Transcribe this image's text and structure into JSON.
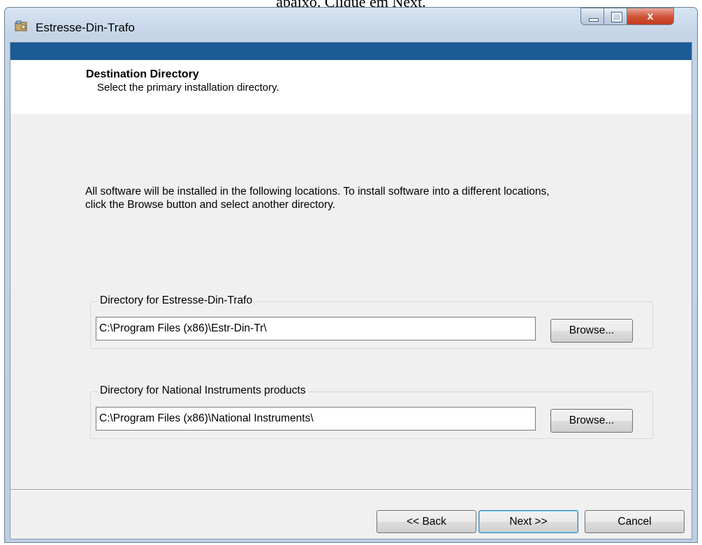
{
  "document_caption": "abaixo. Clique em Next.",
  "window": {
    "title": "Estresse-Din-Trafo",
    "controls": {
      "close_glyph": "x"
    }
  },
  "header": {
    "title": "Destination Directory",
    "subtitle": "Select the primary installation directory."
  },
  "description": "All software will be installed in the following locations. To install software into a different locations, click the Browse button and select another directory.",
  "directories": [
    {
      "label": "Directory for Estresse-Din-Trafo",
      "path": "C:\\Program Files (x86)\\Estr-Din-Tr\\",
      "browse_label": "Browse..."
    },
    {
      "label": "Directory for National Instruments products",
      "path": "C:\\Program Files (x86)\\National Instruments\\",
      "browse_label": "Browse..."
    }
  ],
  "buttons": {
    "back": "<< Back",
    "next": "Next >>",
    "cancel": "Cancel"
  },
  "colors": {
    "header_strip": "#1b5b96",
    "close_button": "#c23b20"
  },
  "icons": {
    "app": "installer-icon",
    "minimize": "minimize-icon",
    "maximize": "maximize-icon",
    "close": "close-icon"
  }
}
